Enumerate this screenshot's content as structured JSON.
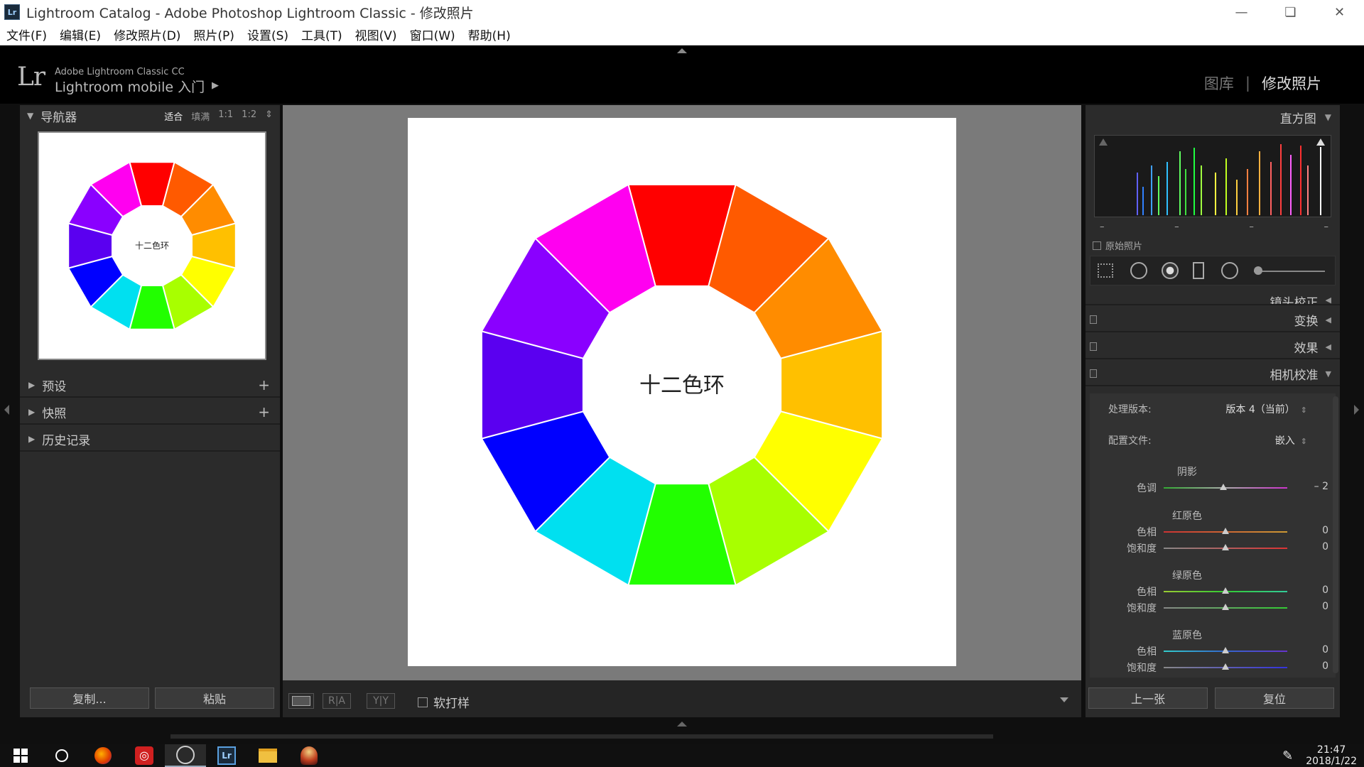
{
  "window": {
    "title": "Lightroom Catalog - Adobe Photoshop Lightroom Classic - 修改照片",
    "app_icon_text": "Lr"
  },
  "menu": [
    {
      "label": "文件(F)",
      "name": "menu-file"
    },
    {
      "label": "编辑(E)",
      "name": "menu-edit"
    },
    {
      "label": "修改照片(D)",
      "name": "menu-develop"
    },
    {
      "label": "照片(P)",
      "name": "menu-photo"
    },
    {
      "label": "设置(S)",
      "name": "menu-settings"
    },
    {
      "label": "工具(T)",
      "name": "menu-tools"
    },
    {
      "label": "视图(V)",
      "name": "menu-view"
    },
    {
      "label": "窗口(W)",
      "name": "menu-window"
    },
    {
      "label": "帮助(H)",
      "name": "menu-help"
    }
  ],
  "identity": {
    "logo": "Lr",
    "product": "Adobe Lightroom Classic CC",
    "mobile_link": "Lightroom mobile 入门",
    "modules": [
      "图库",
      "修改照片"
    ],
    "active_module": "修改照片"
  },
  "navigator": {
    "title": "导航器",
    "zoom_options": [
      "适合",
      "填满",
      "1:1",
      "1:2"
    ],
    "active_zoom": "适合",
    "preview_caption": "十二色环"
  },
  "left_panels": [
    {
      "label": "预设",
      "has_add": true
    },
    {
      "label": "快照",
      "has_add": true
    },
    {
      "label": "历史记录",
      "has_add": false
    }
  ],
  "left_buttons": {
    "copy": "复制...",
    "paste": "粘贴"
  },
  "photo": {
    "caption": "十二色环",
    "wheel_colors": [
      "#ff0000",
      "#ff5a00",
      "#ff8c00",
      "#ffc000",
      "#ffff00",
      "#a8ff00",
      "#22ff00",
      "#00e0f0",
      "#0000ff",
      "#5a00f0",
      "#8a00ff",
      "#ff00f0"
    ]
  },
  "toolbar": {
    "view_mode_label": "",
    "before_after_label": "R|A",
    "yy_label": "Y|Y",
    "soft_proof": "软打样"
  },
  "histogram": {
    "title": "直方图",
    "original_photo": "原始照片",
    "values": [
      "–",
      "–",
      "–",
      "–"
    ]
  },
  "sections": [
    {
      "label": "镜头校正",
      "name": "section-lens-corrections"
    },
    {
      "label": "变换",
      "name": "section-transform"
    },
    {
      "label": "效果",
      "name": "section-effects"
    },
    {
      "label": "相机校准",
      "name": "section-camera-calibration"
    }
  ],
  "calibration": {
    "process_label": "处理版本:",
    "process_value": "版本 4（当前）",
    "profile_label": "配置文件:",
    "profile_value": "嵌入",
    "shadows": {
      "title": "阴影",
      "tint_label": "色调",
      "tint_value": "– 2",
      "tint_pos": 0.48
    },
    "red": {
      "title": "红原色",
      "hue_label": "色相",
      "hue_value": "0",
      "sat_label": "饱和度",
      "sat_value": "0"
    },
    "green": {
      "title": "绿原色",
      "hue_label": "色相",
      "hue_value": "0",
      "sat_label": "饱和度",
      "sat_value": "0"
    },
    "blue": {
      "title": "蓝原色",
      "hue_label": "色相",
      "hue_value": "0",
      "sat_label": "饱和度",
      "sat_value": "0"
    }
  },
  "right_buttons": {
    "previous": "上一张",
    "reset": "复位"
  },
  "taskbar": {
    "time": "21:47",
    "date": "2018/1/22"
  },
  "colors": {
    "panel_bg": "#2b2b2b",
    "center_bg": "#7a7a7a",
    "text": "#cccccc"
  }
}
